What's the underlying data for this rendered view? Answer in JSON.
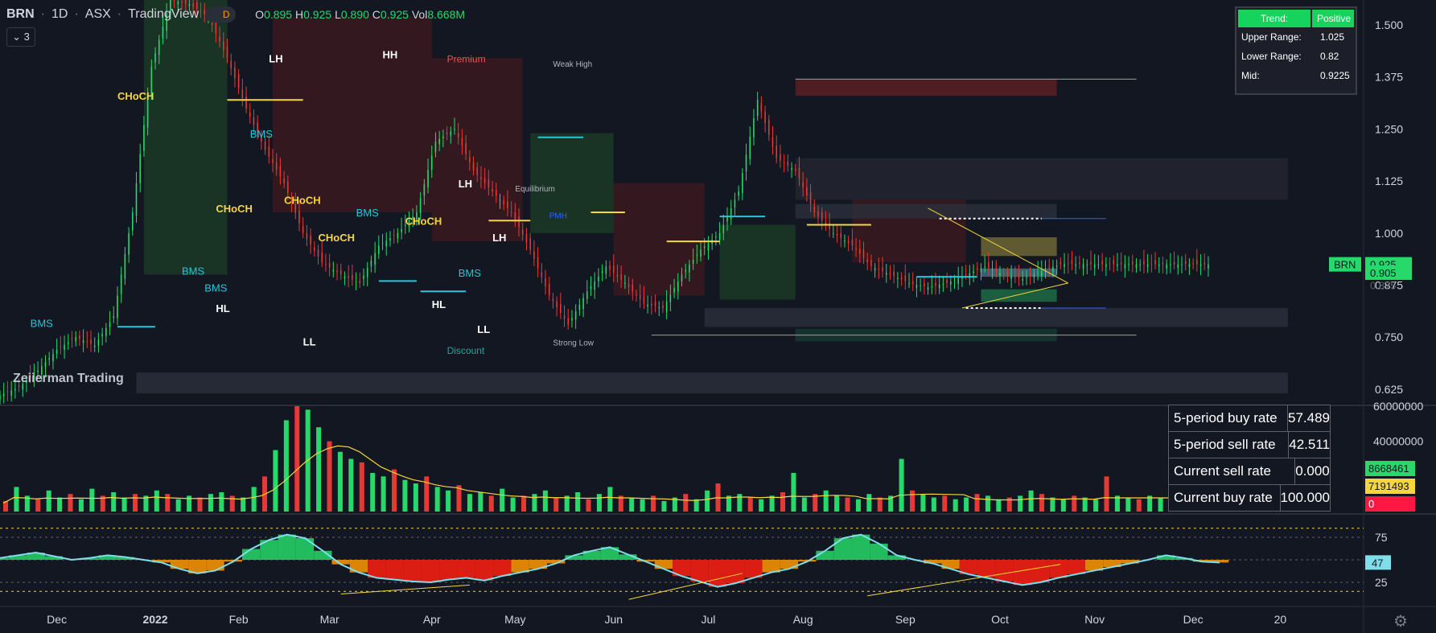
{
  "header": {
    "symbol": "BRN",
    "interval": "1D",
    "exchange": "ASX",
    "source": "TradingView",
    "session_badge": "D",
    "ohlc": {
      "o_label": "O",
      "o": "0.895",
      "h_label": "H",
      "h": "0.925",
      "l_label": "L",
      "l": "0.890",
      "c_label": "C",
      "c": "0.925",
      "vol_label": "Vol",
      "vol": "8.668M"
    },
    "indicator_count": "3"
  },
  "watermark": "Zeiierman Trading",
  "trend_table": {
    "rows": [
      {
        "k": "Trend:",
        "v": "Positive"
      },
      {
        "k": "Upper Range:",
        "v": "1.025"
      },
      {
        "k": "Lower Range:",
        "v": "0.82"
      },
      {
        "k": "Mid:",
        "v": "0.9225"
      }
    ]
  },
  "rates_table": {
    "rows": [
      {
        "k": "5-period buy rate",
        "v": "57.489"
      },
      {
        "k": "5-period sell rate",
        "v": "42.511"
      },
      {
        "k": "Current sell rate",
        "v": "0.000"
      },
      {
        "k": "Current buy rate",
        "v": "100.000"
      }
    ]
  },
  "colors": {
    "bg": "#131722",
    "up": "#26d96a",
    "down": "#e53935",
    "yellow": "#f5d63d",
    "cyan": "#26c6da",
    "grid": "#2a2e39"
  },
  "chart_data": [
    {
      "type": "candlestick",
      "title": "BRN · 1D · ASX",
      "x_ticks": [
        "Dec",
        "2022",
        "Feb",
        "Mar",
        "Apr",
        "May",
        "Jun",
        "Jul",
        "Aug",
        "Sep",
        "Oct",
        "Nov",
        "Dec",
        "20"
      ],
      "y_ticks": [
        "1.500",
        "1.375",
        "1.250",
        "1.125",
        "1.000",
        "0.875",
        "0.750",
        "0.625"
      ],
      "ylim": [
        0.59,
        1.56
      ],
      "last_price_label": {
        "symbol": "BRN",
        "value": "0.925"
      },
      "other_price_labels": [
        "0.925",
        "0.875",
        "0.905"
      ],
      "close_series": {
        "x": [
          0,
          5,
          10,
          15,
          20,
          25,
          30,
          35,
          40,
          45,
          50,
          55,
          60,
          65,
          70,
          75,
          80,
          85,
          90,
          95,
          100,
          105,
          110,
          115,
          120,
          125,
          130,
          135,
          140,
          145,
          150,
          155,
          160,
          165,
          170,
          175,
          180,
          185,
          190,
          195,
          200,
          205,
          210,
          215,
          220,
          225,
          230,
          235,
          240,
          245,
          250,
          255,
          260,
          265,
          270,
          275,
          280,
          285,
          290,
          295,
          300,
          305,
          310,
          315,
          320
        ],
        "y": [
          0.61,
          0.63,
          0.67,
          0.72,
          0.75,
          0.73,
          0.8,
          1.05,
          1.4,
          1.56,
          1.55,
          1.52,
          1.42,
          1.3,
          1.2,
          1.12,
          1.0,
          0.93,
          0.9,
          0.88,
          0.97,
          1.0,
          1.05,
          1.22,
          1.25,
          1.15,
          1.1,
          1.05,
          0.96,
          0.85,
          0.78,
          0.86,
          0.92,
          0.88,
          0.83,
          0.82,
          0.9,
          0.96,
          1.0,
          1.1,
          1.32,
          1.18,
          1.15,
          1.05,
          1.0,
          0.97,
          0.92,
          0.9,
          0.88,
          0.87,
          0.88,
          0.9,
          0.92,
          0.9,
          0.89,
          0.91,
          0.925,
          0.925,
          0.925,
          0.925,
          0.925,
          0.925,
          0.925,
          0.925,
          0.925
        ]
      },
      "annotations": [
        {
          "text": "CHoCH",
          "x": 31,
          "y": 1.32,
          "color": "yellow"
        },
        {
          "text": "BMS",
          "x": 8,
          "y": 0.775,
          "color": "cyan"
        },
        {
          "text": "LH",
          "x": 71,
          "y": 1.41,
          "color": "white"
        },
        {
          "text": "BMS",
          "x": 66,
          "y": 1.23,
          "color": "cyan"
        },
        {
          "text": "CHoCH",
          "x": 57,
          "y": 1.05,
          "color": "yellow"
        },
        {
          "text": "CHoCH",
          "x": 75,
          "y": 1.07,
          "color": "yellow"
        },
        {
          "text": "BMS",
          "x": 48,
          "y": 0.9,
          "color": "cyan"
        },
        {
          "text": "BMS",
          "x": 54,
          "y": 0.86,
          "color": "cyan"
        },
        {
          "text": "HL",
          "x": 57,
          "y": 0.81,
          "color": "white"
        },
        {
          "text": "CHoCH",
          "x": 84,
          "y": 0.98,
          "color": "yellow"
        },
        {
          "text": "BMS",
          "x": 94,
          "y": 1.04,
          "color": "cyan"
        },
        {
          "text": "LL",
          "x": 80,
          "y": 0.73,
          "color": "white"
        },
        {
          "text": "HH",
          "x": 101,
          "y": 1.42,
          "color": "white"
        },
        {
          "text": "Premium",
          "x": 118,
          "y": 1.41,
          "color": "red"
        },
        {
          "text": "Weak High",
          "x": 146,
          "y": 1.4,
          "color": "grey"
        },
        {
          "text": "CHoCH",
          "x": 107,
          "y": 1.02,
          "color": "yellow"
        },
        {
          "text": "LH",
          "x": 121,
          "y": 1.11,
          "color": "white"
        },
        {
          "text": "Equilibrium",
          "x": 136,
          "y": 1.1,
          "color": "grey"
        },
        {
          "text": "PMH",
          "x": 145,
          "y": 1.035,
          "color": "blue"
        },
        {
          "text": "LH",
          "x": 130,
          "y": 0.98,
          "color": "white"
        },
        {
          "text": "BMS",
          "x": 121,
          "y": 0.895,
          "color": "cyan"
        },
        {
          "text": "HL",
          "x": 114,
          "y": 0.82,
          "color": "white"
        },
        {
          "text": "LL",
          "x": 126,
          "y": 0.76,
          "color": "white"
        },
        {
          "text": "Discount",
          "x": 118,
          "y": 0.71,
          "color": "teal"
        },
        {
          "text": "Strong Low",
          "x": 146,
          "y": 0.73,
          "color": "grey"
        }
      ]
    },
    {
      "type": "bar",
      "title": "Volume",
      "y_ticks": [
        "60000000",
        "40000000"
      ],
      "ylim": [
        0,
        60000000
      ],
      "last_values": [
        "8668461",
        "7191493",
        "0"
      ],
      "values": [
        6,
        14,
        9,
        7,
        12,
        8,
        10,
        7,
        13,
        9,
        11,
        8,
        10,
        9,
        12,
        10,
        7,
        9,
        8,
        10,
        11,
        9,
        8,
        14,
        20,
        35,
        52,
        60,
        58,
        48,
        40,
        34,
        30,
        28,
        22,
        20,
        24,
        18,
        16,
        20,
        14,
        12,
        15,
        10,
        11,
        9,
        13,
        8,
        9,
        10,
        12,
        8,
        9,
        11,
        7,
        10,
        14,
        9,
        8,
        7,
        9,
        6,
        8,
        10,
        7,
        12,
        16,
        9,
        10,
        8,
        7,
        9,
        11,
        22,
        8,
        10,
        12,
        9,
        8,
        7,
        10,
        8,
        9,
        30,
        12,
        10,
        8,
        9,
        7,
        8,
        10,
        9,
        7,
        8,
        9,
        12,
        10,
        8,
        7,
        9,
        8,
        7,
        20,
        9,
        8,
        7,
        9,
        8,
        7,
        8,
        6,
        9,
        7
      ]
    },
    {
      "type": "area",
      "title": "Oscillator",
      "y_ticks": [
        "75",
        "25"
      ],
      "ylim": [
        0,
        100
      ],
      "last_value": "47",
      "values": [
        52,
        55,
        58,
        54,
        50,
        52,
        55,
        53,
        50,
        47,
        40,
        35,
        38,
        48,
        62,
        72,
        78,
        74,
        60,
        45,
        36,
        30,
        28,
        26,
        25,
        28,
        30,
        27,
        32,
        36,
        40,
        46,
        55,
        60,
        64,
        56,
        48,
        40,
        32,
        26,
        20,
        24,
        30,
        36,
        40,
        48,
        60,
        74,
        78,
        68,
        55,
        50,
        46,
        40,
        34,
        30,
        26,
        22,
        25,
        30,
        34,
        38,
        42,
        46,
        50,
        55,
        52,
        48,
        47
      ]
    }
  ]
}
